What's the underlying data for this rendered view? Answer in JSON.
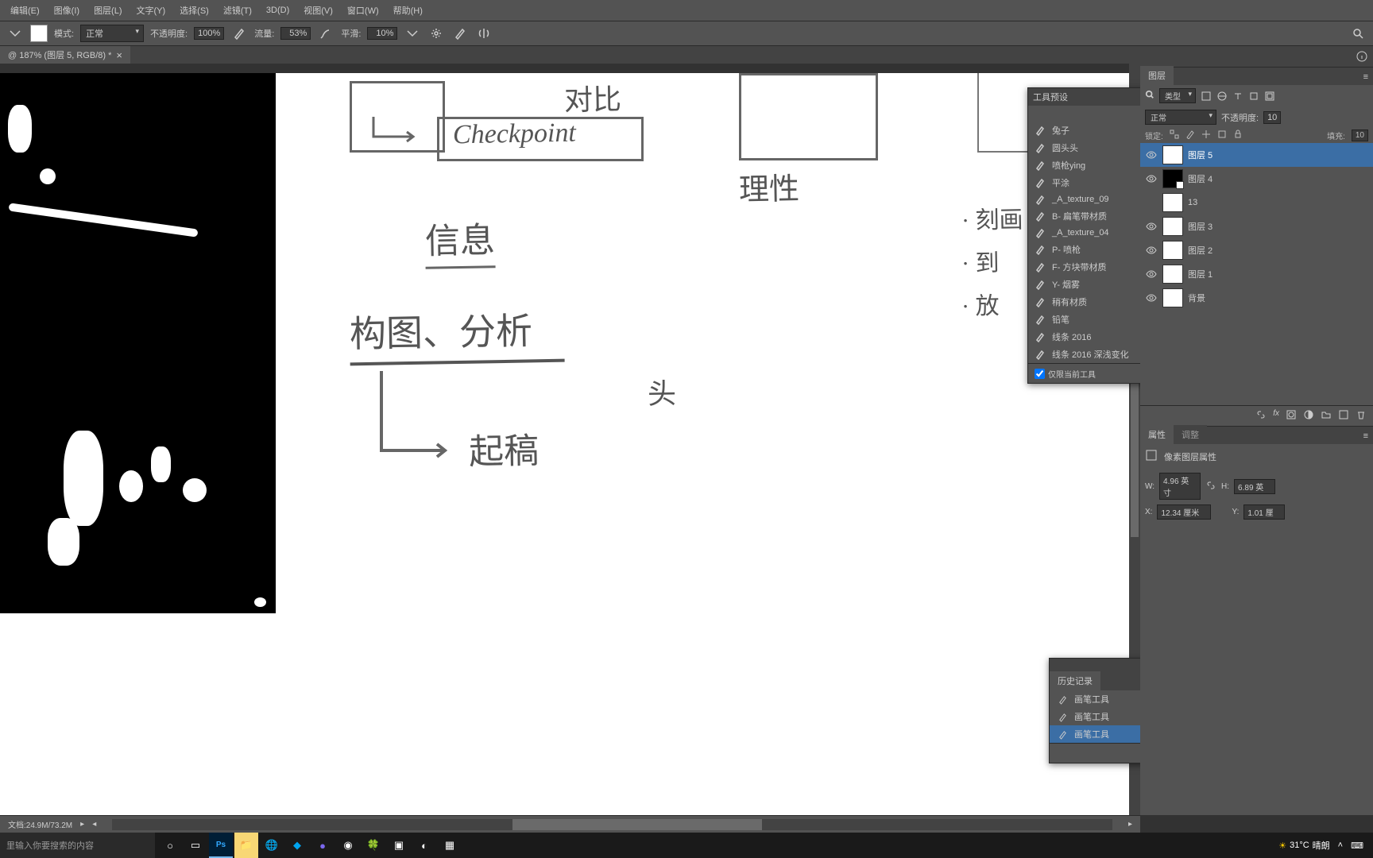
{
  "menu": [
    "编辑(E)",
    "图像(I)",
    "图层(L)",
    "文字(Y)",
    "选择(S)",
    "滤镜(T)",
    "3D(D)",
    "视图(V)",
    "窗口(W)",
    "帮助(H)"
  ],
  "opt": {
    "mode_label": "模式:",
    "mode_value": "正常",
    "opacity_label": "不透明度:",
    "opacity_value": "100%",
    "flow_label": "流量:",
    "flow_value": "53%",
    "smooth_label": "平滑:",
    "smooth_value": "10%"
  },
  "doc": {
    "title": "@ 187% (图层 5, RGB/8) *"
  },
  "presets": {
    "title": "工具预设",
    "items": [
      "兔子",
      "圆头头",
      "喷枪ying",
      "平涂",
      "_A_texture_09",
      "B- 扁笔带材质",
      "_A_texture_04",
      "P- 喷枪",
      "F- 方块带材质",
      "Y- 烟雾",
      "稍有材质",
      "铅笔",
      "线条 2016",
      "线条 2016 深浅变化"
    ],
    "only_current": "仅限当前工具"
  },
  "hist": {
    "title": "历史记录",
    "items": [
      "画笔工具",
      "画笔工具",
      "画笔工具"
    ]
  },
  "layers": {
    "tab": "图层",
    "kind": "类型",
    "blend": "正常",
    "opacity_label": "不透明度:",
    "opacity_value": "10",
    "lock_label": "锁定:",
    "fill_label": "填充:",
    "fill_value": "10",
    "list": [
      {
        "name": "图层 5",
        "vis": true,
        "sel": true,
        "thumb": "white"
      },
      {
        "name": "图层 4",
        "vis": true,
        "thumb": "black"
      },
      {
        "name": "13",
        "vis": false,
        "thumb": "small"
      },
      {
        "name": "图层 3",
        "vis": true,
        "thumb": "white"
      },
      {
        "name": "图层 2",
        "vis": true,
        "thumb": "white"
      },
      {
        "name": "图层 1",
        "vis": true,
        "thumb": "white"
      },
      {
        "name": "背景",
        "vis": true,
        "thumb": "bg"
      }
    ]
  },
  "props": {
    "tab1": "属性",
    "tab2": "调整",
    "subtitle": "像素图层属性",
    "W_lbl": "W:",
    "W": "4.96 英寸",
    "H_lbl": "H:",
    "H": "6.89 英",
    "X_lbl": "X:",
    "X": "12.34 厘米",
    "Y_lbl": "Y:",
    "Y": "1.01 厘"
  },
  "status": {
    "doc_info": "文档:24.9M/73.2M"
  },
  "taskbar": {
    "search_placeholder": "里输入你要搜索的内容",
    "weather_temp": "31°C",
    "weather_text": "晴朗"
  },
  "canvas_text": {
    "t1": "对比",
    "t2": "Checkpoint",
    "t3": "理性",
    "t4": "信息",
    "t5": "构图、分析",
    "t6": "起稿",
    "t7": "头",
    "b1": "刻画",
    "b2": "到",
    "b3": "放"
  }
}
